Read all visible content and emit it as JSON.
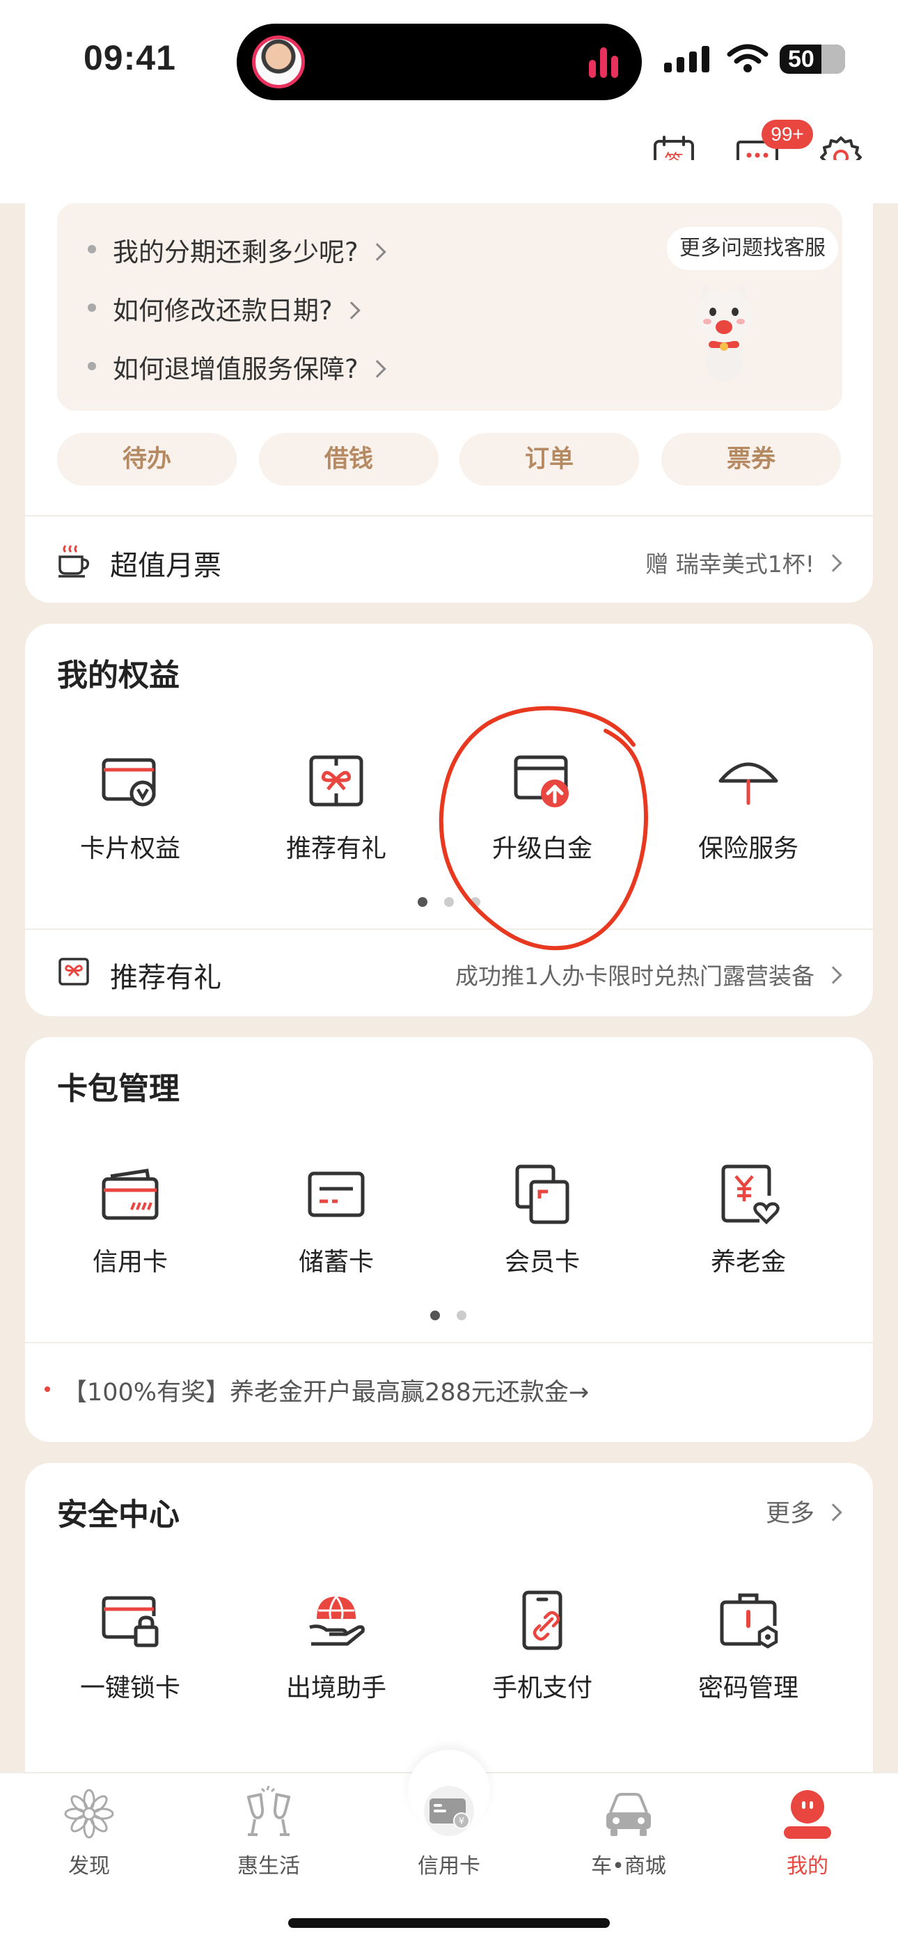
{
  "status_bar": {
    "time": "09:41",
    "battery": "50"
  },
  "header": {
    "checkin_icon_text": "签",
    "message_badge": "99+"
  },
  "help": {
    "faq": [
      "我的分期还剩多少呢?",
      "如何修改还款日期?",
      "如何退增值服务保障?"
    ],
    "more_service": "更多问题找客服"
  },
  "quick_tabs": [
    "待办",
    "借钱",
    "订单",
    "票券"
  ],
  "monthly_ticket": {
    "label": "超值月票",
    "promo": "赠 瑞幸美式1杯!"
  },
  "benefits": {
    "title": "我的权益",
    "items": [
      "卡片权益",
      "推荐有礼",
      "升级白金",
      "保险服务"
    ],
    "footer_label": "推荐有礼",
    "footer_promo": "成功推1人办卡限时兑热门露营装备"
  },
  "wallet": {
    "title": "卡包管理",
    "items": [
      "信用卡",
      "储蓄卡",
      "会员卡",
      "养老金"
    ],
    "promo": "【100%有奖】养老金开户最高赢288元还款金→"
  },
  "security": {
    "title": "安全中心",
    "more": "更多",
    "items": [
      "一键锁卡",
      "出境助手",
      "手机支付",
      "密码管理"
    ]
  },
  "tabbar": [
    "发现",
    "惠生活",
    "信用卡",
    "车•商城",
    "我的"
  ],
  "colors": {
    "accent": "#e8463f",
    "pill_text": "#b58a62",
    "background": "#f4ebe2",
    "annotation": "#e8381f"
  }
}
